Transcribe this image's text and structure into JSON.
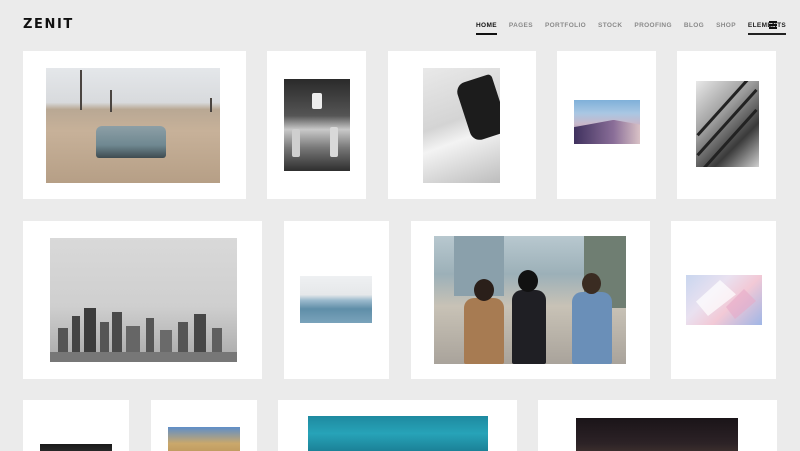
{
  "logo": "ZENIT",
  "nav": [
    {
      "label": "HOME",
      "state": "active"
    },
    {
      "label": "PAGES",
      "state": ""
    },
    {
      "label": "PORTFOLIO",
      "state": ""
    },
    {
      "label": "STOCK",
      "state": ""
    },
    {
      "label": "PROOFING",
      "state": ""
    },
    {
      "label": "BLOG",
      "state": ""
    },
    {
      "label": "SHOP",
      "state": ""
    },
    {
      "label": "ELEMENTS",
      "state": "underlined"
    }
  ],
  "menu_icon": "hamburger-menu-icon",
  "gallery": [
    {
      "name": "gallery-item-desert-road",
      "image": "vintage-car-on-desert-road"
    },
    {
      "name": "gallery-item-dancers",
      "image": "black-and-white-dancers"
    },
    {
      "name": "gallery-item-white-wall",
      "image": "person-on-white-wall"
    },
    {
      "name": "gallery-item-sky-architecture",
      "image": "sky-and-architecture"
    },
    {
      "name": "gallery-item-stairs",
      "image": "black-and-white-stairs"
    },
    {
      "name": "gallery-item-city-skyline",
      "image": "grey-city-skyline"
    },
    {
      "name": "gallery-item-sea",
      "image": "calm-sea-horizon"
    },
    {
      "name": "gallery-item-street-walkers",
      "image": "three-men-walking-street"
    },
    {
      "name": "gallery-item-pastel-geometry",
      "image": "pastel-geometric-shapes"
    },
    {
      "name": "gallery-item-portrait",
      "image": "dark-portrait"
    },
    {
      "name": "gallery-item-building",
      "image": "building-facade"
    },
    {
      "name": "gallery-item-pool",
      "image": "blue-swimming-pool"
    },
    {
      "name": "gallery-item-night",
      "image": "night-scene"
    }
  ]
}
